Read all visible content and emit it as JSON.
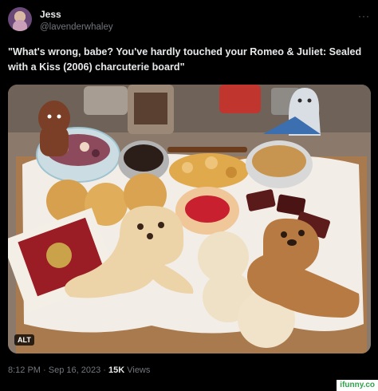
{
  "tweet": {
    "display_name": "Jess",
    "handle": "@lavenderwhaley",
    "more_label": "···",
    "text": "\"What's wrong, babe? You've hardly touched your Romeo & Juliet: Sealed with a Kiss (2006) charcuterie board\"",
    "timestamp": "8:12 PM · Sep 16, 2023",
    "dot": "·",
    "views_count": "15K",
    "views_label": "Views"
  },
  "media": {
    "alt_label": "ALT"
  },
  "watermark": {
    "text": "ifunny.co"
  }
}
